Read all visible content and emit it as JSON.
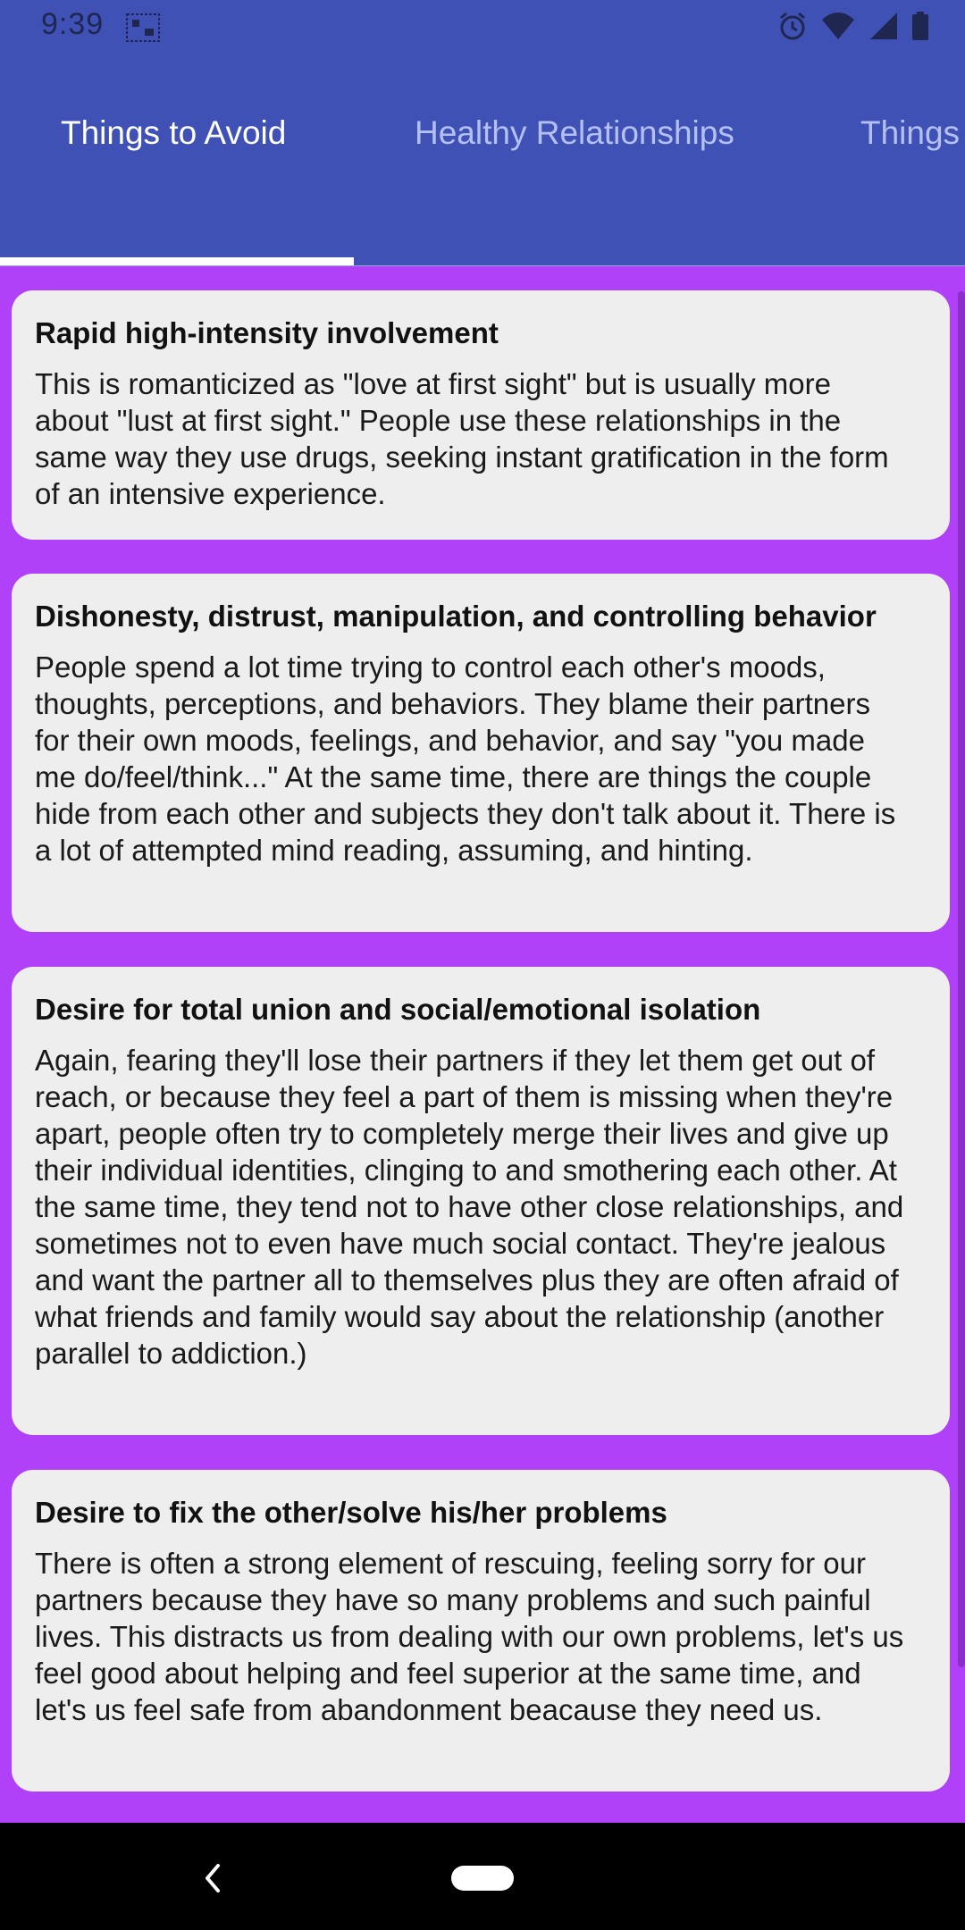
{
  "status_bar": {
    "time": "9:39"
  },
  "tabs": [
    {
      "label": "Things to Avoid",
      "active": true
    },
    {
      "label": "Healthy Relationships",
      "active": false
    },
    {
      "label": "Things",
      "active": false
    }
  ],
  "cards": [
    {
      "title": "Rapid high-intensity involvement",
      "body": "This is romanticized as \"love at first sight\" but is usually more about \"lust at first sight.\" People use these relationships in the same way they use drugs, seeking instant gratification in the form of an intensive experience."
    },
    {
      "title": "Dishonesty, distrust, manipulation, and controlling behavior",
      "body": "People spend a lot time trying to control each other's moods, thoughts, perceptions, and behaviors. They blame their partners for their own moods, feelings, and behavior, and say \"you made me do/feel/think...\" At the same time, there are things the couple hide from each other and subjects they don't talk about it. There is a lot of attempted mind reading, assuming, and hinting."
    },
    {
      "title": "Desire for total union and social/emotional isolation",
      "body": "Again, fearing they'll lose their partners if they let them get out of reach, or because they feel a part of them is missing when they're apart, people often try to completely merge their lives and give up their individual identities, clinging to and smothering each other. At the same time, they tend not to have other close relationships, and sometimes not to even have much social contact. They're jealous and want the partner all to themselves plus they are often afraid of what friends and family would say about the relationship (another parallel to addiction.)"
    },
    {
      "title": "Desire to fix the other/solve his/her problems",
      "body": "There is often a strong element of rescuing, feeling sorry for our partners because they have so many problems and such painful lives. This distracts us from dealing with our own problems, let's us feel good about helping and feel superior at the same time, and let's us feel safe from abandonment beacause they need us."
    }
  ],
  "colors": {
    "app_bar": "#3f51b5",
    "background": "#b041f8",
    "card": "#eeeeee"
  }
}
